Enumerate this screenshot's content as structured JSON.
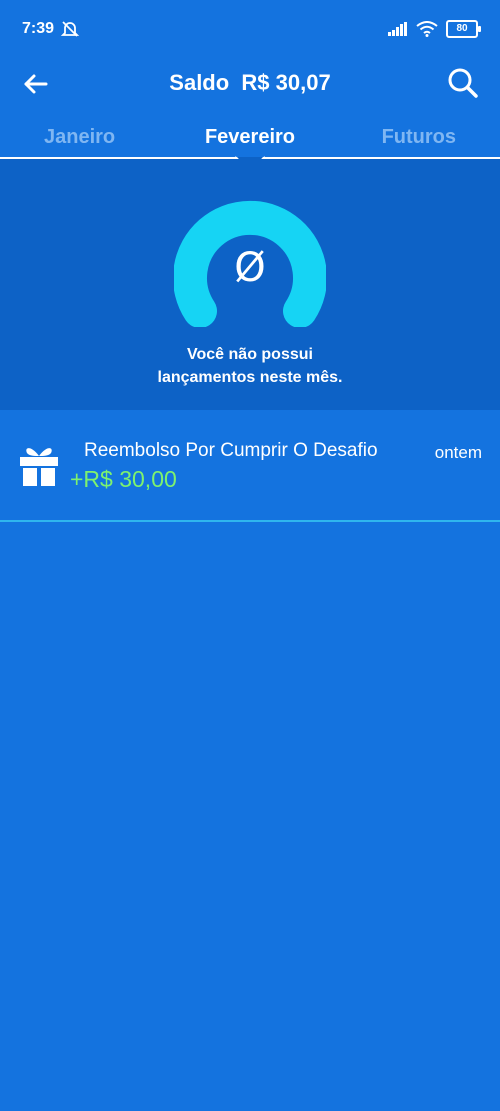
{
  "status_bar": {
    "time": "7:39",
    "battery": "80"
  },
  "header": {
    "title": "Saldo  R$ 30,07"
  },
  "tabs": [
    {
      "label": "Janeiro",
      "active": false
    },
    {
      "label": "Fevereiro",
      "active": true
    },
    {
      "label": "Futuros",
      "active": false
    }
  ],
  "empty_state": {
    "symbol": "Ø",
    "message_line1": "Você não possui",
    "message_line2": "lançamentos neste mês."
  },
  "transactions": [
    {
      "icon": "gift-icon",
      "title": "Reembolso Por Cumprir O Desafio",
      "amount": "+R$ 30,00",
      "date": "ontem"
    }
  ],
  "colors": {
    "background": "#1473df",
    "panel": "#0d62c6",
    "accent_cyan": "#16d4f4",
    "amount_positive": "#7ef26e",
    "divider": "#2fb6ee",
    "inactive_tab": "#7fb6f2"
  }
}
